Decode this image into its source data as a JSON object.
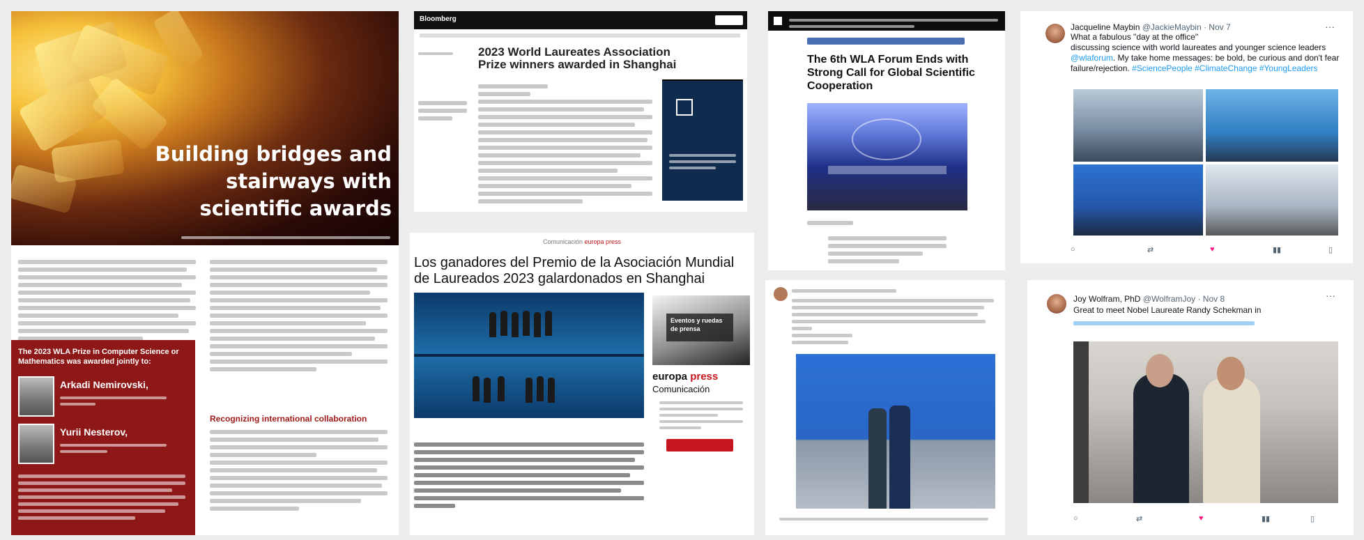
{
  "tile1": {
    "headline": "Building bridges and stairways with scientific awards",
    "prize_box": {
      "title": "The 2023 WLA Prize in Computer Science or Mathematics was awarded jointly to:",
      "laureates": [
        {
          "name": "Arkadi Nemirovski,"
        },
        {
          "name": "Yurii Nesterov,"
        }
      ]
    },
    "subhead": "Recognizing international collaboration"
  },
  "tile2": {
    "brand": "Bloomberg",
    "headline": "2023 World Laureates Association Prize winners awarded in Shanghai"
  },
  "tile3": {
    "source": "Comunicación",
    "source_brand": "europa press",
    "headline": "Los ganadores del Premio de la Asociación Mundial de Laureados 2023 galardonados en Shanghai",
    "ad_overlay": "Eventos y ruedas de prensa",
    "logo_line1_a": "europa",
    "logo_line1_b": "press",
    "logo_line2": "Comunicación"
  },
  "tile4": {
    "headline": "The 6th WLA Forum Ends with Strong Call for Global Scientific Cooperation"
  },
  "tile6": {
    "name": "Jacqueline Maybin",
    "handle": "@JackieMaybin · Nov 7",
    "text_1": "What a fabulous \"day at the office\"",
    "text_2": "discussing science with world laureates and younger science leaders",
    "text_3": ". My take home messages: be bold, be curious and don't fear failure/rejection.",
    "link_1": "@wlaforum",
    "link_2": "#SciencePeople #ClimateChange #YoungLeaders",
    "colors": {
      "accent": "#1d9bf0",
      "like": "#f91880"
    }
  },
  "tile7": {
    "name": "Joy Wolfram, PhD",
    "handle": "@WolframJoy · Nov 8",
    "text": "Great to meet Nobel Laureate Randy Schekman in",
    "colors": {
      "accent": "#1d9bf0",
      "like": "#f91880"
    }
  }
}
